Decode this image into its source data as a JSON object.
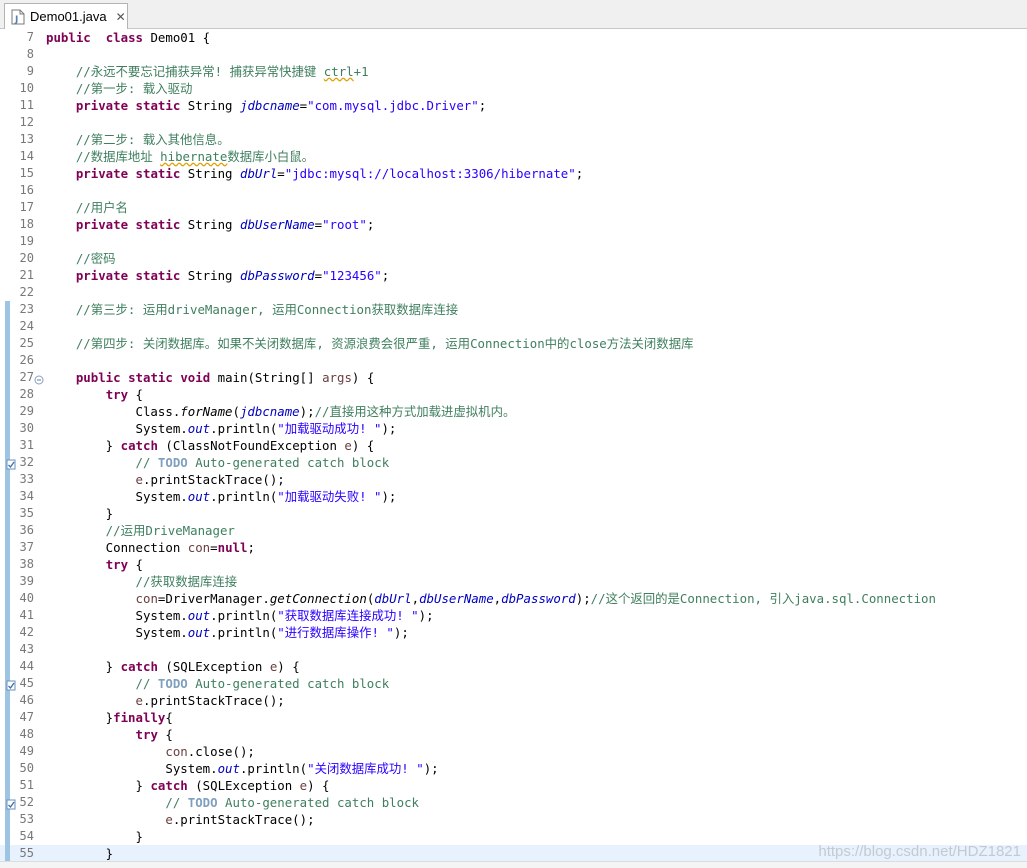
{
  "tab": {
    "label": "Demo01.java",
    "icon": "java-file-icon",
    "close_icon": "close-icon"
  },
  "watermark": "https://blog.csdn.net/HDZ1821",
  "lines": [
    {
      "n": "7",
      "tokens": [
        [
          "kw",
          "public"
        ],
        [
          "",
          "  "
        ],
        [
          "kw",
          "class"
        ],
        [
          "",
          " Demo01 {"
        ]
      ]
    },
    {
      "n": "8",
      "tokens": []
    },
    {
      "n": "9",
      "tokens": [
        [
          "cm",
          "    //永远不要忘记捕获异常! 捕获异常快捷键 "
        ],
        [
          "cmsq",
          "ctrl"
        ],
        [
          "cm",
          "+1"
        ]
      ]
    },
    {
      "n": "10",
      "tokens": [
        [
          "cm",
          "    //第一步: 载入驱动"
        ]
      ]
    },
    {
      "n": "11",
      "tokens": [
        [
          "",
          "    "
        ],
        [
          "kw",
          "private"
        ],
        [
          "",
          " "
        ],
        [
          "kw",
          "static"
        ],
        [
          "",
          " String "
        ],
        [
          "fd",
          "jdbcname"
        ],
        [
          "",
          "="
        ],
        [
          "st",
          "\"com.mysql.jdbc.Driver\""
        ],
        [
          "",
          ";"
        ]
      ]
    },
    {
      "n": "12",
      "tokens": []
    },
    {
      "n": "13",
      "tokens": [
        [
          "cm",
          "    //第二步: 载入其他信息。"
        ]
      ]
    },
    {
      "n": "14",
      "tokens": [
        [
          "cm",
          "    //数据库地址 "
        ],
        [
          "cmsq",
          "hibernate"
        ],
        [
          "cm",
          "数据库小白鼠。"
        ]
      ]
    },
    {
      "n": "15",
      "tokens": [
        [
          "",
          "    "
        ],
        [
          "kw",
          "private"
        ],
        [
          "",
          " "
        ],
        [
          "kw",
          "static"
        ],
        [
          "",
          " String "
        ],
        [
          "fd",
          "dbUrl"
        ],
        [
          "",
          "="
        ],
        [
          "st",
          "\"jdbc:mysql://localhost:3306/hibernate\""
        ],
        [
          "",
          ";"
        ]
      ]
    },
    {
      "n": "16",
      "tokens": []
    },
    {
      "n": "17",
      "tokens": [
        [
          "cm",
          "    //用户名"
        ]
      ]
    },
    {
      "n": "18",
      "tokens": [
        [
          "",
          "    "
        ],
        [
          "kw",
          "private"
        ],
        [
          "",
          " "
        ],
        [
          "kw",
          "static"
        ],
        [
          "",
          " String "
        ],
        [
          "fd",
          "dbUserName"
        ],
        [
          "",
          "="
        ],
        [
          "st",
          "\"root\""
        ],
        [
          "",
          ";"
        ]
      ]
    },
    {
      "n": "19",
      "tokens": []
    },
    {
      "n": "20",
      "tokens": [
        [
          "cm",
          "    //密码"
        ]
      ]
    },
    {
      "n": "21",
      "tokens": [
        [
          "",
          "    "
        ],
        [
          "kw",
          "private"
        ],
        [
          "",
          " "
        ],
        [
          "kw",
          "static"
        ],
        [
          "",
          " String "
        ],
        [
          "fd",
          "dbPassword"
        ],
        [
          "",
          "="
        ],
        [
          "st",
          "\"123456\""
        ],
        [
          "",
          ";"
        ]
      ]
    },
    {
      "n": "22",
      "tokens": []
    },
    {
      "n": "23",
      "tokens": [
        [
          "cm",
          "    //第三步: 运用driveManager, 运用Connection获取数据库连接"
        ]
      ]
    },
    {
      "n": "24",
      "tokens": []
    },
    {
      "n": "25",
      "tokens": [
        [
          "cm",
          "    //第四步: 关闭数据库。如果不关闭数据库, 资源浪费会很严重, 运用Connection中的close方法关闭数据库"
        ]
      ]
    },
    {
      "n": "26",
      "tokens": []
    },
    {
      "n": "27",
      "tokens": [
        [
          "",
          "    "
        ],
        [
          "kw",
          "public"
        ],
        [
          "",
          " "
        ],
        [
          "kw",
          "static"
        ],
        [
          "",
          " "
        ],
        [
          "kw",
          "void"
        ],
        [
          "",
          " main(String[] "
        ],
        [
          "vr",
          "args"
        ],
        [
          "",
          ") {"
        ]
      ]
    },
    {
      "n": "28",
      "tokens": [
        [
          "",
          "        "
        ],
        [
          "kw",
          "try"
        ],
        [
          "",
          " {"
        ]
      ]
    },
    {
      "n": "29",
      "tokens": [
        [
          "",
          "            Class."
        ],
        [
          "sm",
          "forName"
        ],
        [
          "",
          "("
        ],
        [
          "fd",
          "jdbcname"
        ],
        [
          "",
          ");"
        ],
        [
          "cm",
          "//直接用这种方式加载进虚拟机内。"
        ]
      ]
    },
    {
      "n": "30",
      "tokens": [
        [
          "",
          "            System."
        ],
        [
          "so",
          "out"
        ],
        [
          "",
          ".println("
        ],
        [
          "st",
          "\"加载驱动成功! \""
        ],
        [
          "",
          ");"
        ]
      ]
    },
    {
      "n": "31",
      "tokens": [
        [
          "",
          "        } "
        ],
        [
          "kw",
          "catch"
        ],
        [
          "",
          " (ClassNotFoundException "
        ],
        [
          "vr",
          "e"
        ],
        [
          "",
          ") {"
        ]
      ]
    },
    {
      "n": "32",
      "tokens": [
        [
          "cm",
          "            // "
        ],
        [
          "td",
          "TODO"
        ],
        [
          "cm",
          " Auto-generated catch block"
        ]
      ]
    },
    {
      "n": "33",
      "tokens": [
        [
          "",
          "            "
        ],
        [
          "vr",
          "e"
        ],
        [
          "",
          ".printStackTrace();"
        ]
      ]
    },
    {
      "n": "34",
      "tokens": [
        [
          "",
          "            System."
        ],
        [
          "so",
          "out"
        ],
        [
          "",
          ".println("
        ],
        [
          "st",
          "\"加载驱动失败! \""
        ],
        [
          "",
          ");"
        ]
      ]
    },
    {
      "n": "35",
      "tokens": [
        [
          "",
          "        }"
        ]
      ]
    },
    {
      "n": "36",
      "tokens": [
        [
          "cm",
          "        //运用DriveManager"
        ]
      ]
    },
    {
      "n": "37",
      "tokens": [
        [
          "",
          "        Connection "
        ],
        [
          "vr",
          "con"
        ],
        [
          "",
          "="
        ],
        [
          "kw",
          "null"
        ],
        [
          "",
          ";"
        ]
      ]
    },
    {
      "n": "38",
      "tokens": [
        [
          "",
          "        "
        ],
        [
          "kw",
          "try"
        ],
        [
          "",
          " {"
        ]
      ]
    },
    {
      "n": "39",
      "tokens": [
        [
          "cm",
          "            //获取数据库连接"
        ]
      ]
    },
    {
      "n": "40",
      "tokens": [
        [
          "",
          "            "
        ],
        [
          "vr",
          "con"
        ],
        [
          "",
          "=DriverManager."
        ],
        [
          "sm",
          "getConnection"
        ],
        [
          "",
          "("
        ],
        [
          "fd",
          "dbUrl"
        ],
        [
          "",
          ","
        ],
        [
          "fd",
          "dbUserName"
        ],
        [
          "",
          ","
        ],
        [
          "fd",
          "dbPassword"
        ],
        [
          "",
          ");"
        ],
        [
          "cm",
          "//这个返回的是Connection, 引入java.sql.Connection"
        ]
      ]
    },
    {
      "n": "41",
      "tokens": [
        [
          "",
          "            System."
        ],
        [
          "so",
          "out"
        ],
        [
          "",
          ".println("
        ],
        [
          "st",
          "\"获取数据库连接成功! \""
        ],
        [
          "",
          ");"
        ]
      ]
    },
    {
      "n": "42",
      "tokens": [
        [
          "",
          "            System."
        ],
        [
          "so",
          "out"
        ],
        [
          "",
          ".println("
        ],
        [
          "st",
          "\"进行数据库操作! \""
        ],
        [
          "",
          ");"
        ]
      ]
    },
    {
      "n": "43",
      "tokens": []
    },
    {
      "n": "44",
      "tokens": [
        [
          "",
          "        } "
        ],
        [
          "kw",
          "catch"
        ],
        [
          "",
          " (SQLException "
        ],
        [
          "vr",
          "e"
        ],
        [
          "",
          ") {"
        ]
      ]
    },
    {
      "n": "45",
      "tokens": [
        [
          "cm",
          "            // "
        ],
        [
          "td",
          "TODO"
        ],
        [
          "cm",
          " Auto-generated catch block"
        ]
      ]
    },
    {
      "n": "46",
      "tokens": [
        [
          "",
          "            "
        ],
        [
          "vr",
          "e"
        ],
        [
          "",
          ".printStackTrace();"
        ]
      ]
    },
    {
      "n": "47",
      "tokens": [
        [
          "",
          "        }"
        ],
        [
          "kw",
          "finally"
        ],
        [
          "",
          "{"
        ]
      ]
    },
    {
      "n": "48",
      "tokens": [
        [
          "",
          "            "
        ],
        [
          "kw",
          "try"
        ],
        [
          "",
          " {"
        ]
      ]
    },
    {
      "n": "49",
      "tokens": [
        [
          "",
          "                "
        ],
        [
          "vr",
          "con"
        ],
        [
          "",
          ".close();"
        ]
      ]
    },
    {
      "n": "50",
      "tokens": [
        [
          "",
          "                System."
        ],
        [
          "so",
          "out"
        ],
        [
          "",
          ".println("
        ],
        [
          "st",
          "\"关闭数据库成功! \""
        ],
        [
          "",
          ");"
        ]
      ]
    },
    {
      "n": "51",
      "tokens": [
        [
          "",
          "            } "
        ],
        [
          "kw",
          "catch"
        ],
        [
          "",
          " (SQLException "
        ],
        [
          "vr",
          "e"
        ],
        [
          "",
          ") {"
        ]
      ]
    },
    {
      "n": "52",
      "tokens": [
        [
          "cm",
          "                // "
        ],
        [
          "td",
          "TODO"
        ],
        [
          "cm",
          " Auto-generated catch block"
        ]
      ]
    },
    {
      "n": "53",
      "tokens": [
        [
          "",
          "                "
        ],
        [
          "vr",
          "e"
        ],
        [
          "",
          ".printStackTrace();"
        ]
      ]
    },
    {
      "n": "54",
      "tokens": [
        [
          "",
          "            }"
        ]
      ]
    },
    {
      "n": "55",
      "tokens": [
        [
          "",
          "        }"
        ]
      ]
    }
  ],
  "current_line": "55",
  "fold_lines": [
    "27"
  ],
  "task_lines": [
    "32",
    "45",
    "52"
  ],
  "colors": {
    "keyword": "#7f0055",
    "comment": "#3f7f5f",
    "string": "#2a00ff",
    "field": "#0000c0",
    "task_tag": "#7f9fbf",
    "current_line_bg": "#e8f2fe",
    "change_marker": "#9ec4e4"
  }
}
